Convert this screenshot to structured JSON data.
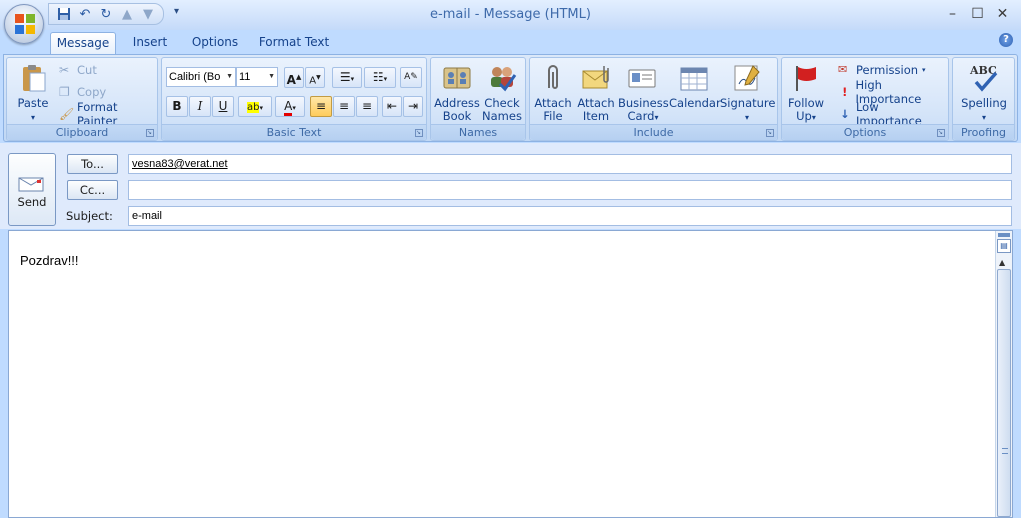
{
  "window": {
    "title": "e-mail - Message (HTML)",
    "controls": [
      "–",
      "☐",
      "✕"
    ]
  },
  "tabs": [
    {
      "label": "Message",
      "active": true
    },
    {
      "label": "Insert",
      "active": false
    },
    {
      "label": "Options",
      "active": false
    },
    {
      "label": "Format Text",
      "active": false
    }
  ],
  "ribbon": {
    "clipboard": {
      "label": "Clipboard",
      "paste": "Paste",
      "cut": "Cut",
      "copy": "Copy",
      "format_painter": "Format Painter"
    },
    "basic_text": {
      "label": "Basic Text",
      "font": "Calibri (Bo",
      "size": "11",
      "bold": "B",
      "italic": "I",
      "underline": "U"
    },
    "names": {
      "label": "Names",
      "address_book_1": "Address",
      "address_book_2": "Book",
      "check_names_1": "Check",
      "check_names_2": "Names"
    },
    "include": {
      "label": "Include",
      "attach_file_1": "Attach",
      "attach_file_2": "File",
      "attach_item_1": "Attach",
      "attach_item_2": "Item",
      "business_card_1": "Business",
      "business_card_2": "Card",
      "calendar": "Calendar",
      "signature": "Signature"
    },
    "options": {
      "label": "Options",
      "follow_up_1": "Follow",
      "follow_up_2": "Up",
      "permission": "Permission",
      "high_importance": "High Importance",
      "low_importance": "Low Importance"
    },
    "proofing": {
      "label": "Proofing",
      "spelling": "Spelling"
    }
  },
  "header": {
    "send": "Send",
    "to_button": "To...",
    "cc_button": "Cc...",
    "subject_label": "Subject:",
    "to_value": "vesna83@verat.net",
    "cc_value": "",
    "subject_value": "e-mail"
  },
  "body": {
    "text": "Pozdrav!!!"
  },
  "colors": {
    "ribbon_bg": "#c8dcf6",
    "accent": "#15428b"
  }
}
